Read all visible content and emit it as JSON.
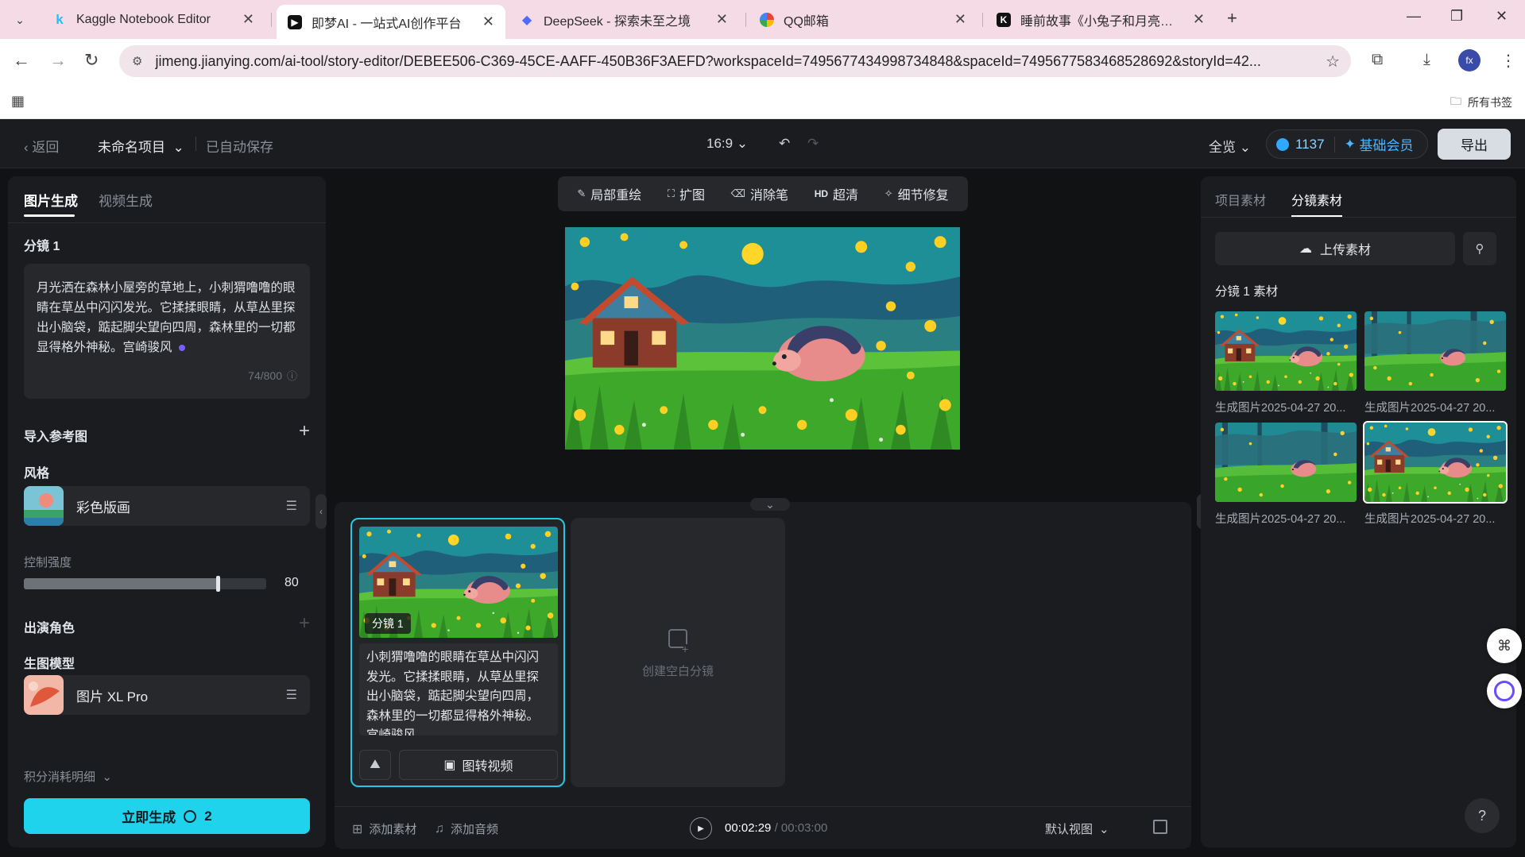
{
  "browser": {
    "tabs": [
      {
        "label": "Kaggle Notebook Editor",
        "favicon": "kaggle-k",
        "favicon_color": "#20beff",
        "active": false
      },
      {
        "label": "即梦AI - 一站式AI创作平台",
        "favicon": "jimeng-logo",
        "favicon_color": "#111111",
        "active": true
      },
      {
        "label": "DeepSeek - 探索未至之境",
        "favicon": "deepseek-whale",
        "favicon_color": "#4d6bfe",
        "active": false
      },
      {
        "label": "QQ邮箱",
        "favicon": "qq-mail",
        "favicon_color": "#f4b400",
        "active": false
      },
      {
        "label": "睡前故事《小兔子和月亮》分镜",
        "favicon": "kling-k",
        "favicon_color": "#111111",
        "active": false
      }
    ],
    "url": "jimeng.jianying.com/ai-tool/story-editor/DEBEE506-C369-45CE-AAFF-450B36F3AEFD?workspaceId=7495677434998734848&spaceId=7495677583468528692&storyId=42...",
    "profile_initials": "fx",
    "bookmarks_label": "所有书签"
  },
  "header": {
    "back_label": "返回",
    "project_name": "未命名项目",
    "autosave": "已自动保存",
    "ratio": "16:9",
    "view_mode": "全览",
    "credits": "1137",
    "membership": "基础会员",
    "export_label": "导出"
  },
  "left": {
    "tabs": [
      "图片生成",
      "视频生成"
    ],
    "shot_title": "分镜 1",
    "prompt": "月光洒在森林小屋旁的草地上，小刺猬噜噜的眼睛在草丛中闪闪发光。它揉揉眼睛，从草丛里探出小脑袋，踮起脚尖望向四周，森林里的一切都显得格外神秘。宫崎骏风",
    "prompt_count": "74/800",
    "import_ref": "导入参考图",
    "style_label": "风格",
    "style_name": "彩色版画",
    "control_label": "控制强度",
    "control_value": 80,
    "control_value_text": "80",
    "cast_label": "出演角色",
    "model_label": "生图模型",
    "model_name": "图片 XL Pro",
    "cost_label": "积分消耗明细",
    "generate_label": "立即生成",
    "generate_cost": "2"
  },
  "center": {
    "tools": [
      {
        "label": "局部重绘",
        "icon": "brush-icon"
      },
      {
        "label": "扩图",
        "icon": "expand-icon"
      },
      {
        "label": "消除笔",
        "icon": "eraser-icon"
      },
      {
        "label": "超清",
        "icon": "hd-icon",
        "icon_text": "HD"
      },
      {
        "label": "细节修复",
        "icon": "magic-wand-icon"
      }
    ],
    "shot_badge": "分镜 1",
    "shot_text": "小刺猬噜噜的眼睛在草丛中闪闪发光。它揉揉眼睛，从草丛里探出小脑袋，踮起脚尖望向四周，森林里的一切都显得格外神秘。宫崎骏风",
    "img2video_label": "图转视频",
    "blank_shot_label": "创建空白分镜",
    "add_asset": "添加素材",
    "add_audio": "添加音频",
    "time_current": "00:02:29",
    "time_total": "/ 00:03:00",
    "default_view": "默认视图"
  },
  "right": {
    "tabs": [
      "项目素材",
      "分镜素材"
    ],
    "upload_label": "上传素材",
    "section_title": "分镜 1 素材",
    "assets": [
      {
        "caption": "生成图片2025-04-27 20..."
      },
      {
        "caption": "生成图片2025-04-27 20..."
      },
      {
        "caption": "生成图片2025-04-27 20..."
      },
      {
        "caption": "生成图片2025-04-27 20..."
      }
    ]
  },
  "colors": {
    "accent_cyan": "#1fd3ec",
    "selected_border": "#25c8e4",
    "credit_blue": "#4bb6ff"
  }
}
